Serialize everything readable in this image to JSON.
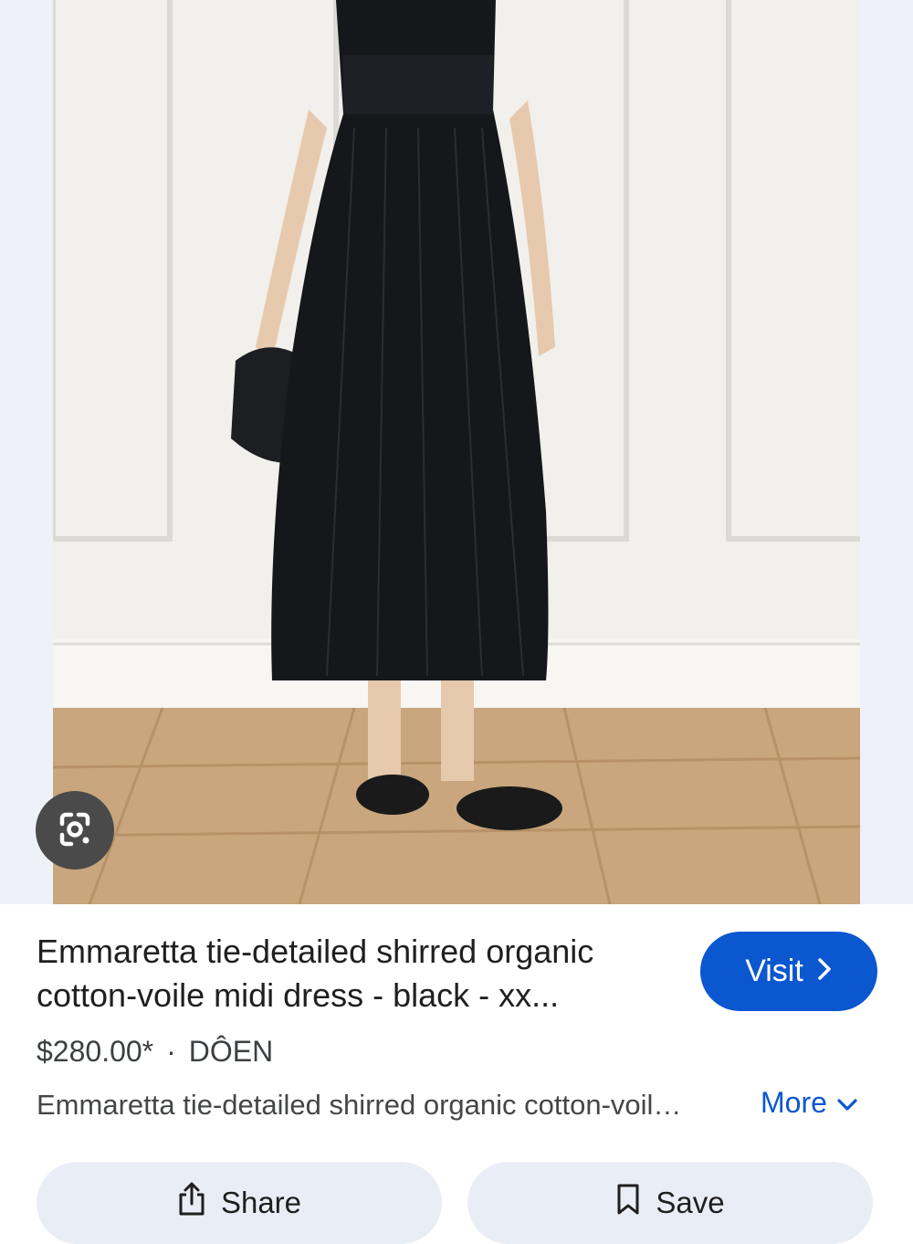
{
  "product": {
    "title_line1": "Emmaretta tie-detailed shirred organic",
    "title_line2": "cotton-voile midi dress - black - xx...",
    "price": "$280.00*",
    "separator": "·",
    "brand": "DÔEN",
    "description": "Emmaretta tie-detailed shirred organic cotton-voil…"
  },
  "actions": {
    "visit_label": "Visit",
    "more_label": "More",
    "share_label": "Share",
    "save_label": "Save"
  },
  "icons": {
    "lens": "google-lens-icon",
    "visit_chevron": "chevron-right-icon",
    "more_chevron": "chevron-down-icon",
    "share": "share-icon",
    "save": "bookmark-icon"
  },
  "colors": {
    "accent": "#0b57d0",
    "button_bg": "#e9eef6",
    "lens_bg": "#4a4a4a"
  }
}
